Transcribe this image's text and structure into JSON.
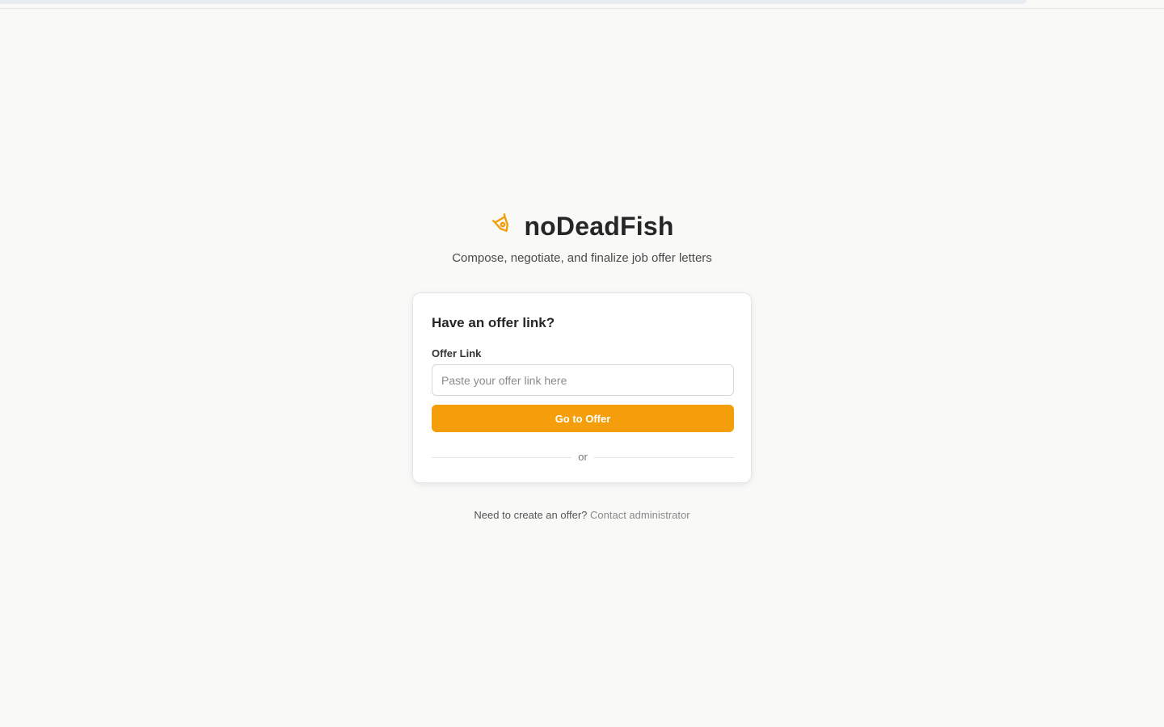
{
  "brand": {
    "name": "noDeadFish",
    "icon": "pen-nib-icon",
    "accent_color": "#f49e0b"
  },
  "subtitle": "Compose, negotiate, and finalize job offer letters",
  "card": {
    "title": "Have an offer link?",
    "field_label": "Offer Link",
    "input_value": "",
    "input_placeholder": "Paste your offer link here",
    "button_label": "Go to Offer",
    "divider_text": "or"
  },
  "footer": {
    "prompt": "Need to create an offer?",
    "link_label": "Contact administrator"
  }
}
